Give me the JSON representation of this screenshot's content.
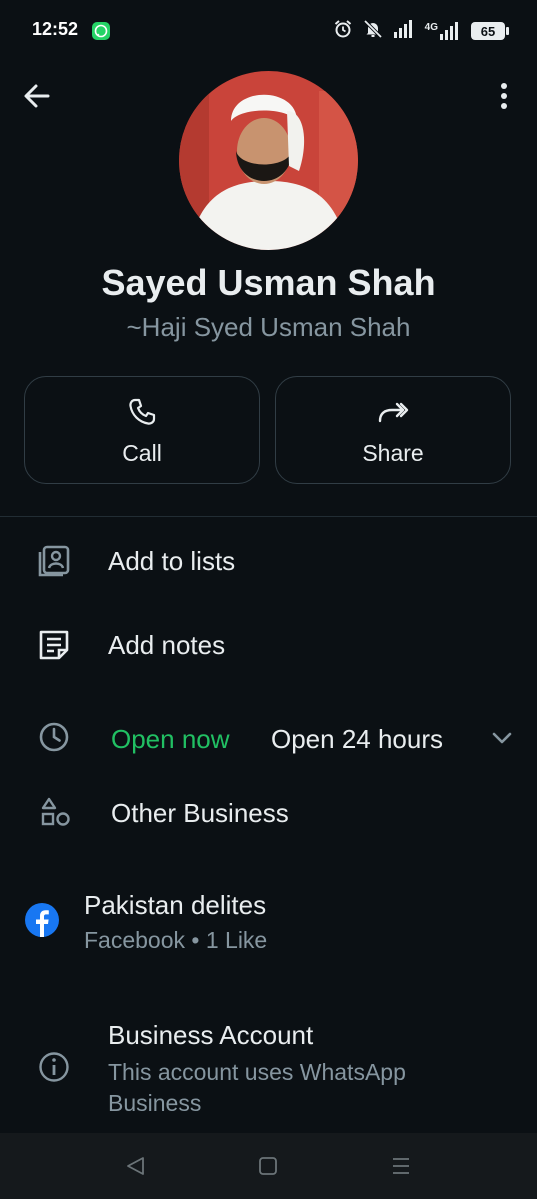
{
  "status_bar": {
    "time": "12:52",
    "battery": "65",
    "network": "4G"
  },
  "profile": {
    "name": "Sayed Usman Shah",
    "pushname": "~Haji Syed Usman Shah"
  },
  "actions": [
    {
      "label": "Call",
      "icon": "phone-icon"
    },
    {
      "label": "Share",
      "icon": "share-icon"
    }
  ],
  "menu": {
    "add_to_lists": "Add to lists",
    "add_notes": "Add notes"
  },
  "business": {
    "open_status": "Open now",
    "hours": "Open 24 hours",
    "category": "Other Business",
    "facebook_page": "Pakistan delites",
    "facebook_meta": "Facebook • 1 Like",
    "account_title": "Business Account",
    "account_desc": "This account uses WhatsApp Business"
  },
  "colors": {
    "background": "#0b1014",
    "accent_green": "#21c063",
    "facebook_blue": "#1877f2",
    "muted_text": "#8696a0"
  }
}
